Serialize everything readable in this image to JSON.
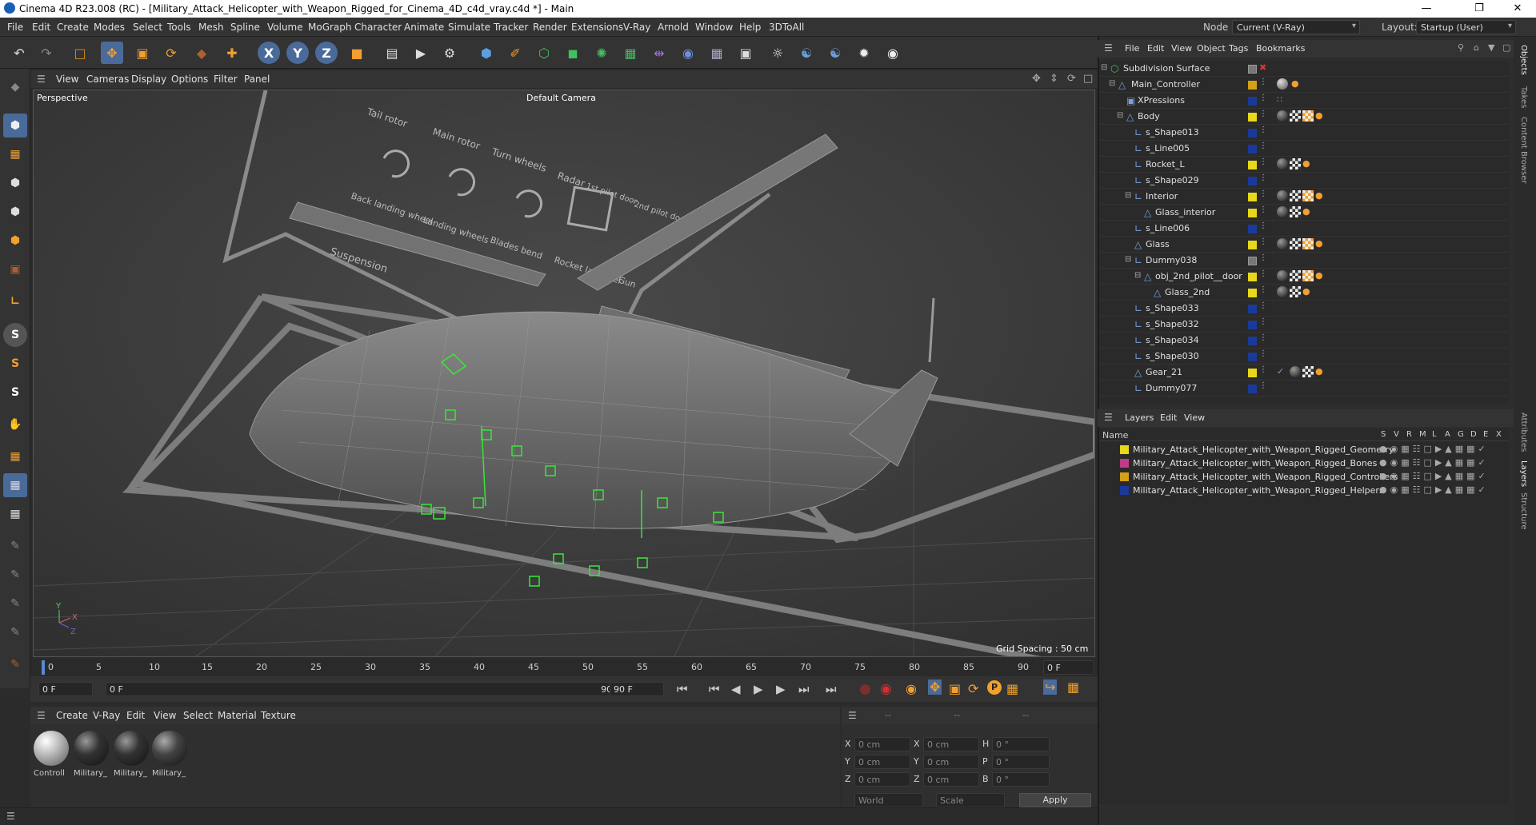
{
  "window": {
    "title": "Cinema 4D R23.008 (RC) - [Military_Attack_Helicopter_with_Weapon_Rigged_for_Cinema_4D_c4d_vray.c4d *] - Main",
    "node_space_label": "Node Space:",
    "node_space_value": "Current (V-Ray)",
    "layout_label": "Layout:",
    "layout_value": "Startup (User)"
  },
  "menu": [
    "File",
    "Edit",
    "Create",
    "Modes",
    "Select",
    "Tools",
    "Mesh",
    "Spline",
    "Volume",
    "MoGraph",
    "Character",
    "Animate",
    "Simulate",
    "Tracker",
    "Render",
    "Extensions",
    "V-Ray",
    "Arnold",
    "Window",
    "Help",
    "3DToAll"
  ],
  "viewport": {
    "menu": [
      "View",
      "Cameras",
      "Display",
      "Options",
      "Filter",
      "Panel"
    ],
    "label": "Perspective",
    "camera": "Default Camera",
    "grid_spacing": "Grid Spacing : 50 cm",
    "hud_labels": [
      "Tail rotor",
      "Main rotor",
      "Turn wheels",
      "Radar",
      "1st pilot door",
      "2nd pilot door",
      "Back landing wheel",
      "Landing wheels",
      "Blades bend",
      "Rocket launcher",
      "Gun",
      "Suspension"
    ]
  },
  "timeline": {
    "ticks": [
      "0",
      "5",
      "10",
      "15",
      "20",
      "25",
      "30",
      "35",
      "40",
      "45",
      "50",
      "55",
      "60",
      "65",
      "70",
      "75",
      "80",
      "85",
      "90"
    ],
    "current": "0 F",
    "start": "0 F",
    "range_start": "0 F",
    "range_end": "90 F",
    "end": "90 F"
  },
  "materials": {
    "menu": [
      "Create",
      "V-Ray",
      "Edit",
      "View",
      "Select",
      "Material",
      "Texture"
    ],
    "items": [
      "Controll",
      "Military_",
      "Military_",
      "Military_"
    ]
  },
  "coords": {
    "headers": [
      "--",
      "--",
      "--"
    ],
    "rows": [
      {
        "a": "X",
        "av": "0 cm",
        "b": "X",
        "bv": "0 cm",
        "c": "H",
        "cv": "0 °"
      },
      {
        "a": "Y",
        "av": "0 cm",
        "b": "Y",
        "bv": "0 cm",
        "c": "P",
        "cv": "0 °"
      },
      {
        "a": "Z",
        "av": "0 cm",
        "b": "Z",
        "bv": "0 cm",
        "c": "B",
        "cv": "0 °"
      }
    ],
    "world": "World",
    "scale": "Scale",
    "apply": "Apply"
  },
  "objects": {
    "menu": [
      "File",
      "Edit",
      "View",
      "Object",
      "Tags",
      "Bookmarks"
    ],
    "rows": [
      {
        "name": "Subdivision Surface",
        "color": "#888888"
      },
      {
        "name": "Main_Controller",
        "color": "#d4a017"
      },
      {
        "name": "XPressions",
        "color": "#1a3a9a"
      },
      {
        "name": "Body",
        "color": "#e8d81a"
      },
      {
        "name": "s_Shape013",
        "color": "#1a3a9a"
      },
      {
        "name": "s_Line005",
        "color": "#1a3a9a"
      },
      {
        "name": "Rocket_L",
        "color": "#e8d81a"
      },
      {
        "name": "s_Shape029",
        "color": "#1a3a9a"
      },
      {
        "name": "Interior",
        "color": "#e8d81a"
      },
      {
        "name": "Glass_interior",
        "color": "#e8d81a"
      },
      {
        "name": "s_Line006",
        "color": "#1a3a9a"
      },
      {
        "name": "Glass",
        "color": "#e8d81a"
      },
      {
        "name": "Dummy038",
        "color": "#888888"
      },
      {
        "name": "obj_2nd_pilot__door",
        "color": "#e8d81a"
      },
      {
        "name": "Glass_2nd",
        "color": "#e8d81a"
      },
      {
        "name": "s_Shape033",
        "color": "#1a3a9a"
      },
      {
        "name": "s_Shape032",
        "color": "#1a3a9a"
      },
      {
        "name": "s_Shape034",
        "color": "#1a3a9a"
      },
      {
        "name": "s_Shape030",
        "color": "#1a3a9a"
      },
      {
        "name": "Gear_21",
        "color": "#e8d81a"
      },
      {
        "name": "Dummy077",
        "color": "#1a3a9a"
      }
    ]
  },
  "layers": {
    "menu": [
      "Layers",
      "Edit",
      "View"
    ],
    "name_header": "Name",
    "flags": [
      "S",
      "V",
      "R",
      "M",
      "L",
      "A",
      "G",
      "D",
      "E",
      "X"
    ],
    "rows": [
      {
        "name": "Military_Attack_Helicopter_with_Weapon_Rigged_Geometry",
        "color": "#e8d81a"
      },
      {
        "name": "Military_Attack_Helicopter_with_Weapon_Rigged_Bones",
        "color": "#c03a8a"
      },
      {
        "name": "Military_Attack_Helicopter_with_Weapon_Rigged_Controllers",
        "color": "#d4a017"
      },
      {
        "name": "Military_Attack_Helicopter_with_Weapon_Rigged_Helpers",
        "color": "#1a3a9a"
      }
    ]
  },
  "side_tabs": [
    "Objects",
    "Takes",
    "Content Browser",
    "Attributes",
    "Layers",
    "Structure"
  ]
}
